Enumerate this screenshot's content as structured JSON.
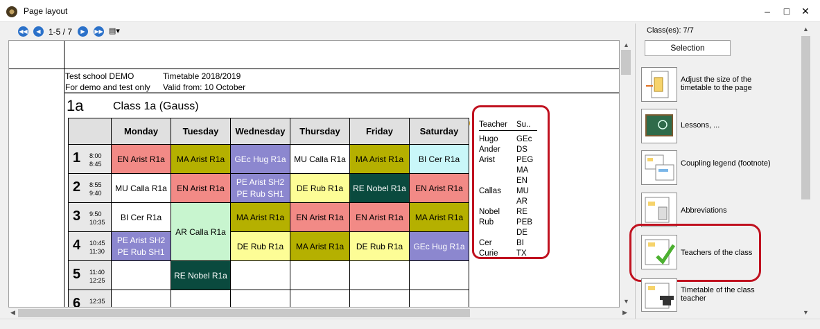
{
  "window": {
    "title": "Page layout"
  },
  "toolbar": {
    "pager": "1-5 / 7"
  },
  "header": {
    "school": "Test school  DEMO",
    "subtitle": "For demo and test only",
    "timetable": "Timetable 2018/2019",
    "valid": "Valid from: 10 October"
  },
  "class": {
    "code": "1a",
    "name": "Class 1a (Gauss)"
  },
  "days": [
    "Monday",
    "Tuesday",
    "Wednesday",
    "Thursday",
    "Friday",
    "Saturday"
  ],
  "periods": [
    {
      "num": "1",
      "start": "8:00",
      "end": "8:45"
    },
    {
      "num": "2",
      "start": "8:55",
      "end": "9:40"
    },
    {
      "num": "3",
      "start": "9:50",
      "end": "10:35"
    },
    {
      "num": "4",
      "start": "10:45",
      "end": "11:30"
    },
    {
      "num": "5",
      "start": "11:40",
      "end": "12:25"
    },
    {
      "num": "6",
      "start": "12:35",
      "end": ""
    }
  ],
  "lessons": {
    "p1": [
      "EN Arist R1a",
      "MA Arist R1a",
      "GEc Hug R1a",
      "MU Calla R1a",
      "MA Arist R1a",
      "BI Cer R1a"
    ],
    "p2_mon": "MU Calla R1a",
    "p2_tue": "EN Arist R1a",
    "p2_wed1": "PE Arist SH2",
    "p2_wed2": "PE Rub SH1",
    "p2_thu": "DE Rub R1a",
    "p2_fri": "RE Nobel R1a",
    "p2_sat": "EN Arist R1a",
    "p3_mon": "BI Cer R1a",
    "p34_tue": "AR Calla R1a",
    "p3_wed": "MA Arist R1a",
    "p3_thu": "EN Arist R1a",
    "p3_fri": "EN Arist R1a",
    "p3_sat": "MA Arist R1a",
    "p4_mon1": "PE Arist SH2",
    "p4_mon2": "PE Rub SH1",
    "p4_wed": "DE Rub R1a",
    "p4_thu": "MA Arist R1a",
    "p4_fri": "DE Rub R1a",
    "p4_sat": "GEc Hug R1a",
    "p5_tue": "RE Nobel R1a"
  },
  "legend": {
    "col_teacher": "Teacher",
    "col_subject": "Su..",
    "rows": [
      {
        "t": "Hugo",
        "s": "GEc"
      },
      {
        "t": "Ander",
        "s": "DS"
      },
      {
        "t": "Arist",
        "s": "PEG"
      },
      {
        "t": "",
        "s": "MA"
      },
      {
        "t": "",
        "s": "EN"
      },
      {
        "t": "Callas",
        "s": "MU"
      },
      {
        "t": "",
        "s": "AR"
      },
      {
        "t": "Nobel",
        "s": "RE"
      },
      {
        "t": "Rub",
        "s": "PEB"
      },
      {
        "t": "",
        "s": "DE"
      },
      {
        "t": "Cer",
        "s": "BI"
      },
      {
        "t": "Curie",
        "s": "TX"
      }
    ]
  },
  "right_panel": {
    "classes_label": "Class(es): 7/7",
    "selection_button": "Selection",
    "options": [
      {
        "label": "Adjust the size of the timetable to the page"
      },
      {
        "label": "Lessons, ..."
      },
      {
        "label": "Coupling legend (footnote)"
      },
      {
        "label": "Abbreviations"
      },
      {
        "label": "Teachers of the class"
      },
      {
        "label": "Timetable of the class teacher"
      }
    ]
  },
  "colors": {
    "salmon": "#f28a86",
    "olive": "#b5b000",
    "lavender": "#8c87cf",
    "yellow": "#fdfd96",
    "teal": "#0a4a3e",
    "mint": "#c8f5cf",
    "aqua": "#c9f7f9",
    "highlight": "#c0111f"
  }
}
